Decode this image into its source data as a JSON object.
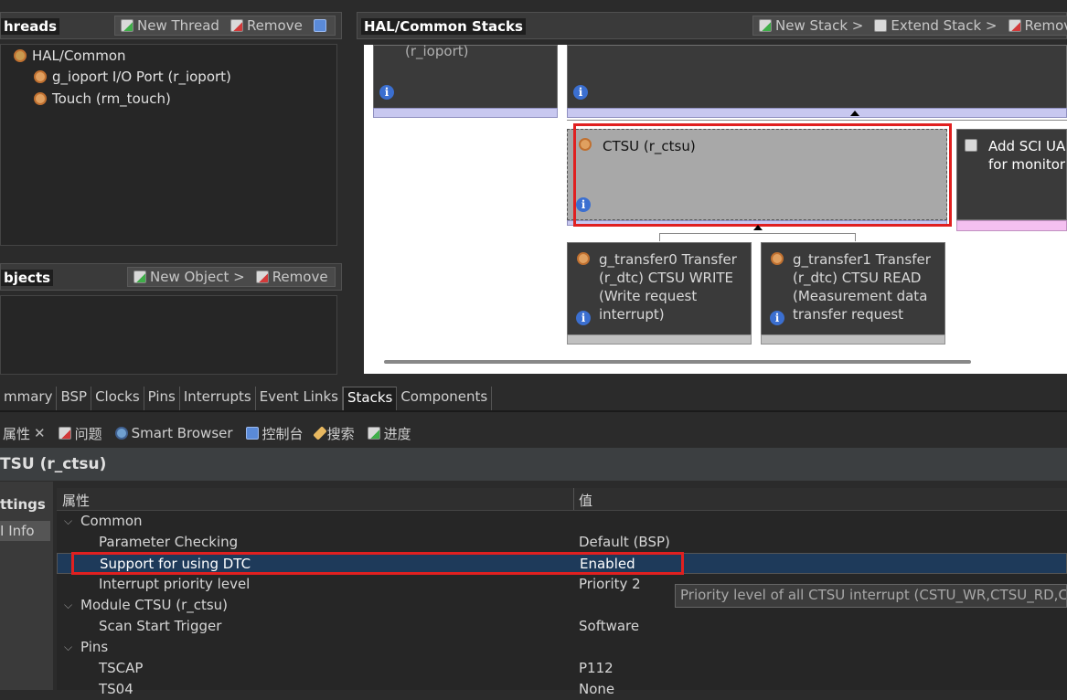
{
  "threads_panel": {
    "title": "hreads",
    "new_thread": "New Thread",
    "remove": "Remove",
    "tree": [
      {
        "label": "HAL/Common",
        "icon": "hal-common-icon"
      },
      {
        "label": "g_ioport I/O Port (r_ioport)",
        "icon": "module-gear-icon"
      },
      {
        "label": "Touch (rm_touch)",
        "icon": "module-gear-icon"
      }
    ]
  },
  "objects_panel": {
    "title": "bjects",
    "new_object": "New Object >",
    "remove": "Remove"
  },
  "stacks_panel": {
    "title": "HAL/Common Stacks",
    "new_stack": "New Stack >",
    "extend_stack": "Extend Stack >",
    "remove": "Remov"
  },
  "modules": {
    "ioport_partial": "(r_ioport)",
    "ctsu": "CTSU (r_ctsu)",
    "add_sci_line1": "Add SCI UA",
    "add_sci_line2": "for monitor",
    "transfer0": "g_transfer0 Transfer (r_dtc) CTSU WRITE (Write request interrupt)",
    "transfer1": "g_transfer1 Transfer (r_dtc) CTSU READ (Measurement data transfer request"
  },
  "editor_tabs": [
    {
      "label": "mmary"
    },
    {
      "label": "BSP"
    },
    {
      "label": "Clocks"
    },
    {
      "label": "Pins"
    },
    {
      "label": "Interrupts"
    },
    {
      "label": "Event Links"
    },
    {
      "label": "Stacks",
      "active": true
    },
    {
      "label": "Components"
    }
  ],
  "view_tabs": {
    "properties": "属性",
    "problems": "问题",
    "smart_browser": "Smart Browser",
    "console": "控制台",
    "search": "搜索",
    "progress": "进度"
  },
  "properties": {
    "title": "TSU (r_ctsu)",
    "side_tabs": [
      "ttings",
      "I Info"
    ],
    "col_property": "属性",
    "col_value": "值",
    "rows": [
      {
        "k": "Common",
        "v": "",
        "group": true
      },
      {
        "k": "Parameter Checking",
        "v": "Default (BSP)"
      },
      {
        "k": "Support for using DTC",
        "v": "Enabled",
        "selected": true
      },
      {
        "k": "Interrupt priority level",
        "v": "Priority 2"
      },
      {
        "k": "Module  CTSU (r_ctsu)",
        "v": "",
        "group": true
      },
      {
        "k": "Scan Start Trigger",
        "v": "Software"
      },
      {
        "k": "Pins",
        "v": "",
        "group": true
      },
      {
        "k": "TSCAP",
        "v": "P112"
      },
      {
        "k": "TS04",
        "v": "None"
      }
    ],
    "tooltip": "Priority level of all CTSU interrupt (CSTU_WR,CTSU_RD,CTS"
  },
  "colors": {
    "highlight_red": "#e02020",
    "selected_row": "#1e3a5a",
    "module_bar_lavender": "#c8c8f0",
    "module_bar_pink": "#f4c0f0"
  }
}
